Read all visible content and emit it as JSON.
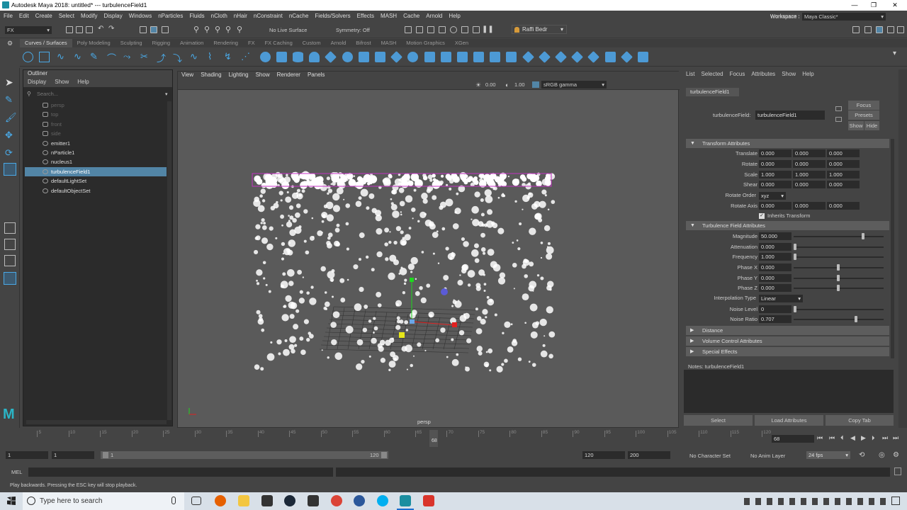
{
  "titlebar": {
    "title": "Autodesk Maya 2018: untitled*   ---   turbulenceField1",
    "min": "—",
    "max": "❐",
    "close": "✕"
  },
  "menubar": [
    "File",
    "Edit",
    "Create",
    "Select",
    "Modify",
    "Display",
    "Windows",
    "nParticles",
    "Fluids",
    "nCloth",
    "nHair",
    "nConstraint",
    "nCache",
    "Fields/Solvers",
    "Effects",
    "MASH",
    "Cache",
    "Arnold",
    "Help"
  ],
  "statusline": {
    "mode": "FX",
    "live": "No Live Surface",
    "symmetry": "Symmetry: Off",
    "user": "Raffi Bedr",
    "workspace_label": "Workspace :",
    "workspace": "Maya Classic*"
  },
  "shelf_tabs": [
    "Curves / Surfaces",
    "Poly Modeling",
    "Sculpting",
    "Rigging",
    "Animation",
    "Rendering",
    "FX",
    "FX Caching",
    "Custom",
    "Arnold",
    "Bifrost",
    "MASH",
    "Motion Graphics",
    "XGen"
  ],
  "outliner": {
    "title": "Outliner",
    "menu": [
      "Display",
      "Show",
      "Help"
    ],
    "search_placeholder": "Search...",
    "items": [
      {
        "label": "persp",
        "dim": true
      },
      {
        "label": "top",
        "dim": true
      },
      {
        "label": "front",
        "dim": true
      },
      {
        "label": "side",
        "dim": true
      },
      {
        "label": "emitter1"
      },
      {
        "label": "nParticle1"
      },
      {
        "label": "nucleus1"
      },
      {
        "label": "turbulenceField1",
        "sel": true
      },
      {
        "label": "defaultLightSet"
      },
      {
        "label": "defaultObjectSet"
      }
    ]
  },
  "viewport": {
    "menu": [
      "View",
      "Shading",
      "Lighting",
      "Show",
      "Renderer",
      "Panels"
    ],
    "val1": "0.00",
    "val2": "1.00",
    "colorspace": "sRGB gamma",
    "camera": "persp"
  },
  "attr": {
    "menu": [
      "List",
      "Selected",
      "Focus",
      "Attributes",
      "Show",
      "Help"
    ],
    "tab": "turbulenceField1",
    "node_label": "turbulenceField:",
    "node_value": "turbulenceField1",
    "focus": "Focus",
    "presets": "Presets",
    "show": "Show",
    "hide": "Hide",
    "transform_title": "Transform Attributes",
    "translate": {
      "label": "Translate",
      "v": [
        "0.000",
        "0.000",
        "0.000"
      ]
    },
    "rotate": {
      "label": "Rotate",
      "v": [
        "0.000",
        "0.000",
        "0.000"
      ]
    },
    "scale": {
      "label": "Scale",
      "v": [
        "1.000",
        "1.000",
        "1.000"
      ]
    },
    "shear": {
      "label": "Shear",
      "v": [
        "0.000",
        "0.000",
        "0.000"
      ]
    },
    "rotate_order": {
      "label": "Rotate Order",
      "v": "xyz"
    },
    "rotate_axis": {
      "label": "Rotate Axis",
      "v": [
        "0.000",
        "0.000",
        "0.000"
      ]
    },
    "inherits": "Inherits Transform",
    "turb_title": "Turbulence Field Attributes",
    "magnitude": {
      "label": "Magnitude",
      "v": "50.000",
      "level": 0.79
    },
    "attenuation": {
      "label": "Attenuation",
      "v": "0.000",
      "level": 0
    },
    "frequency": {
      "label": "Frequency",
      "v": "1.000",
      "level": 0
    },
    "phasex": {
      "label": "Phase X",
      "v": "0.000",
      "level": 0.5
    },
    "phasey": {
      "label": "Phase Y",
      "v": "0.000",
      "level": 0.5
    },
    "phasez": {
      "label": "Phase Z",
      "v": "0.000",
      "level": 0.5
    },
    "interp": {
      "label": "Interpolation Type",
      "v": "Linear"
    },
    "noise_level": {
      "label": "Noise Level",
      "v": "0",
      "level": 0
    },
    "noise_ratio": {
      "label": "Noise Ratio",
      "v": "0.707",
      "level": 0.707
    },
    "distance": "Distance",
    "volume": "Volume Control Attributes",
    "special": "Special Effects",
    "notes": "Notes: turbulenceField1",
    "btn_select": "Select",
    "btn_load": "Load Attributes",
    "btn_copy": "Copy Tab"
  },
  "timeline": {
    "ticks": [
      "5",
      "10",
      "15",
      "20",
      "25",
      "30",
      "35",
      "40",
      "45",
      "50",
      "55",
      "60",
      "65",
      "70",
      "75",
      "80",
      "85",
      "90",
      "95",
      "100",
      "105",
      "110",
      "115",
      "120"
    ],
    "current": "68",
    "frame_field": "68"
  },
  "range": {
    "start": "1",
    "start2": "1",
    "slider_start": "1",
    "slider_end": "120",
    "end": "120",
    "end2": "200",
    "charset": "No Character Set",
    "animlayer": "No Anim Layer",
    "fps": "24 fps"
  },
  "cmd": {
    "label": "MEL"
  },
  "help": "Play backwards. Pressing the ESC key will stop playback.",
  "taskbar": {
    "search": "Type here to search"
  }
}
